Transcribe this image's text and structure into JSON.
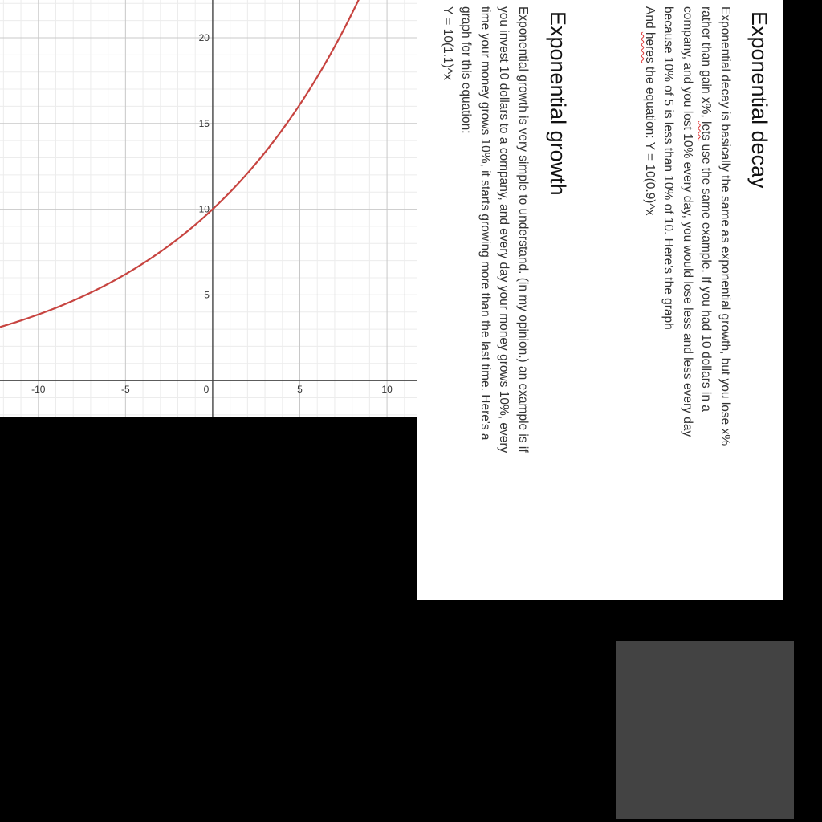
{
  "decay": {
    "title": "Exponential decay",
    "lines": [
      [
        "Exponential decay is basically the same as exponential growth, but you lose x%"
      ],
      [
        "rather than gain x%, ",
        "lets",
        " use the same example. If you had 10 dollars in a"
      ],
      [
        "company, and you lost 10% every day, you would lose less and less every day"
      ],
      [
        "because 10% of 5 is less than 10% of 10. Here's the graph"
      ],
      [
        "And ",
        "heres",
        " the equation: Y = 10(0.9)^x"
      ]
    ]
  },
  "growth": {
    "title": "Exponential growth",
    "lines": [
      "Exponential growth is very simple to understand. (in my opinion.) an example is if",
      "you invest 10 dollars to a company, and every day your money grows 10%, every",
      "time your money grows 10%, it starts growing more than the last time. Here's a",
      "graph for this equation:",
      "Y = 10(1.1)^x"
    ]
  },
  "colors": {
    "curve": "#c74440",
    "sheet": "#ffffff",
    "background": "#000000",
    "block": "#434343"
  },
  "chart_data": {
    "type": "line",
    "title": "",
    "xlabel": "",
    "ylabel": "",
    "equation": "y = 10(1.1)^x",
    "base": 1.1,
    "initial": 10,
    "x_ticks": [
      -10,
      -5,
      0,
      5,
      10
    ],
    "y_ticks": [
      5,
      10,
      15,
      20
    ],
    "xlim": [
      -12.2,
      11.7
    ],
    "ylim": [
      -2.1,
      22.2
    ],
    "grid": true,
    "series": [
      {
        "x": [
          -12.2,
          -10,
          -8,
          -6,
          -4,
          -2,
          0,
          2,
          4,
          6,
          8,
          8.4
        ],
        "values": [
          3.13,
          3.86,
          4.67,
          5.64,
          6.83,
          8.26,
          10,
          12.1,
          14.64,
          17.72,
          21.44,
          22.3
        ]
      }
    ]
  }
}
